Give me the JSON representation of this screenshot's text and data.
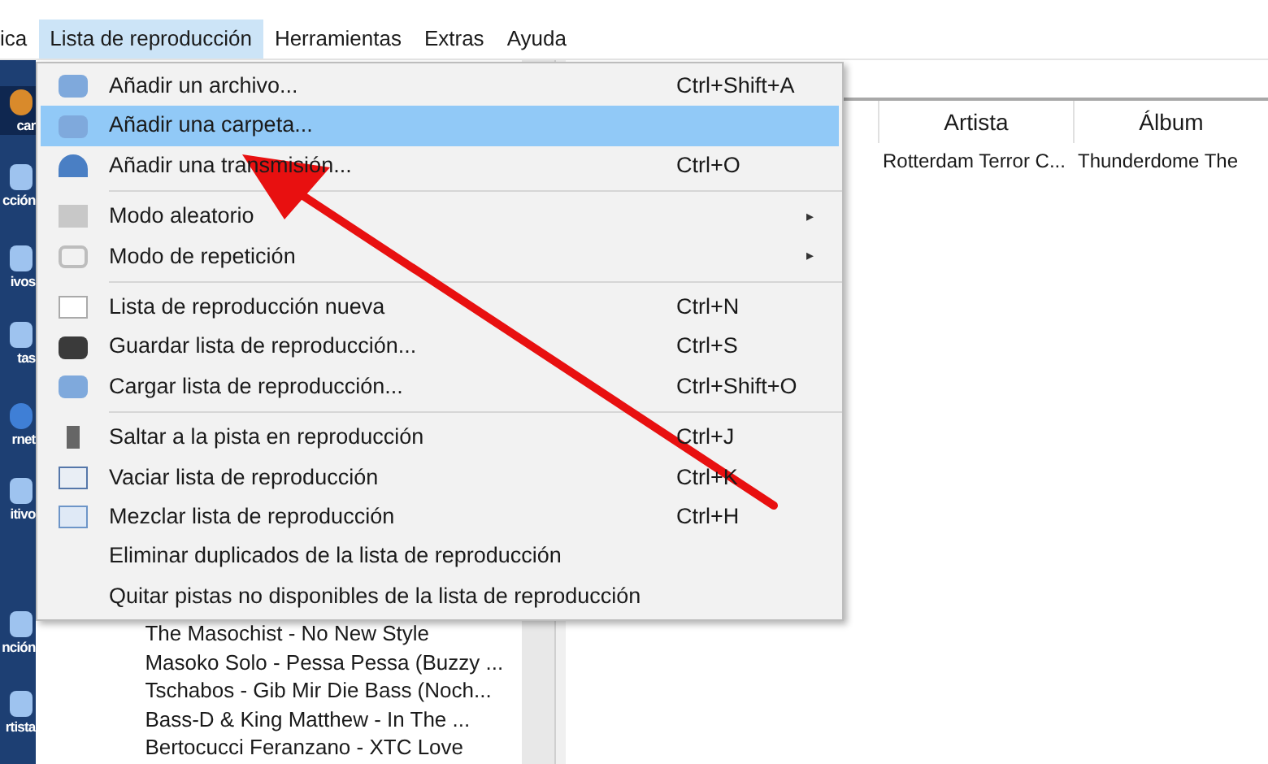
{
  "menu_bar": [
    {
      "label": "ica",
      "selected": false
    },
    {
      "label": "Lista de reproducción",
      "selected": true
    },
    {
      "label": "Herramientas",
      "selected": false
    },
    {
      "label": "Extras",
      "selected": false
    },
    {
      "label": "Ayuda",
      "selected": false
    }
  ],
  "sidebar": {
    "items": [
      {
        "label": "car",
        "selected": true,
        "kind": "search"
      },
      {
        "label": "cción",
        "selected": false,
        "kind": "library"
      },
      {
        "label": "ivos",
        "selected": false,
        "kind": "files"
      },
      {
        "label": "tas",
        "selected": false,
        "kind": "lists"
      },
      {
        "label": "rnet",
        "selected": false,
        "kind": "internet"
      },
      {
        "label": "itivo",
        "selected": false,
        "kind": "device"
      },
      {
        "label": "nción",
        "selected": false,
        "kind": "song"
      },
      {
        "label": "rtista",
        "selected": false,
        "kind": "artist"
      }
    ]
  },
  "track_list": [
    "The Masochist - No New Style",
    "Masoko Solo - Pessa Pessa (Buzzy ...",
    "Tschabos - Gib Mir Die Bass (Noch...",
    "Bass-D & King Matthew - In The ...",
    "Bertocucci Feranzano - XTC Love"
  ],
  "playlist": {
    "columns": [
      "Artista",
      "Álbum"
    ],
    "rows": [
      [
        "Rotterdam Terror C...",
        "Thunderdome The"
      ]
    ]
  },
  "dropdown_menu": {
    "items": [
      {
        "kind": "item",
        "label": "Añadir un archivo...",
        "shortcut": "Ctrl+Shift+A",
        "selected": false
      },
      {
        "kind": "item",
        "label": "Añadir una carpeta...",
        "selected": true
      },
      {
        "kind": "item",
        "label": "Añadir una transmisión...",
        "shortcut": "Ctrl+O",
        "selected": false
      },
      {
        "kind": "separator"
      },
      {
        "kind": "submenu",
        "label": "Modo aleatorio",
        "arrow": "▸",
        "selected": false
      },
      {
        "kind": "submenu",
        "label": "Modo de repetición",
        "arrow": "▸",
        "selected": false
      },
      {
        "kind": "separator"
      },
      {
        "kind": "item",
        "label": "Lista de reproducción nueva",
        "shortcut": "Ctrl+N",
        "selected": false
      },
      {
        "kind": "item",
        "label": "Guardar lista de reproducción...",
        "shortcut": "Ctrl+S",
        "selected": false
      },
      {
        "kind": "item",
        "label": "Cargar lista de reproducción...",
        "shortcut": "Ctrl+Shift+O",
        "selected": false
      },
      {
        "kind": "separator"
      },
      {
        "kind": "item",
        "label": "Saltar a la pista en reproducción",
        "shortcut": "Ctrl+J",
        "selected": false
      },
      {
        "kind": "item",
        "label": "Vaciar lista de reproducción",
        "shortcut": "Ctrl+K",
        "selected": false
      },
      {
        "kind": "item",
        "label": "Mezclar lista de reproducción",
        "shortcut": "Ctrl+H",
        "selected": false
      },
      {
        "kind": "item",
        "label": "Eliminar duplicados de la lista de reproducción",
        "selected": false
      },
      {
        "kind": "item",
        "label": "Quitar pistas no disponibles de la lista de reproducción",
        "selected": false
      }
    ]
  }
}
